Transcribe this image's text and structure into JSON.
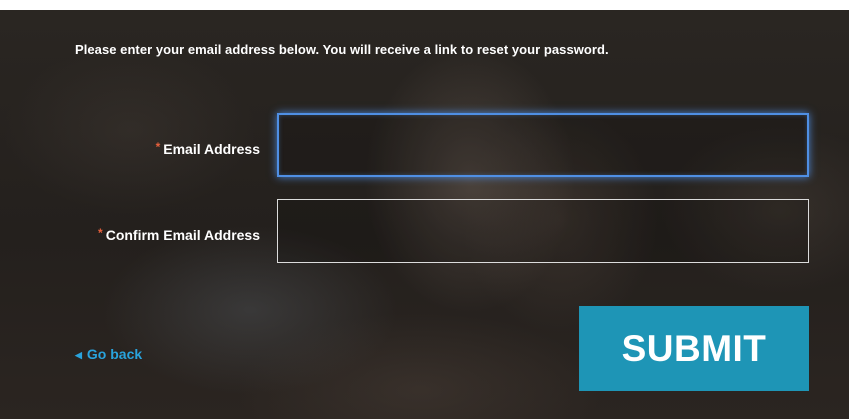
{
  "form": {
    "instructions": "Please enter your email address below. You will receive a link to reset your password.",
    "required_marker": "*",
    "email_label": "Email Address",
    "email_value": "",
    "confirm_email_label": "Confirm Email Address",
    "confirm_email_value": "",
    "go_back_icon": "chevron-left-icon",
    "go_back_label": "Go back",
    "submit_label": "SUBMIT"
  },
  "colors": {
    "accent_blue": "#29a3dd",
    "submit_bg": "#1e95b6",
    "focus_border": "#4f8fe4",
    "required_marker": "#e8603c",
    "panel_bg": "#26221f"
  }
}
